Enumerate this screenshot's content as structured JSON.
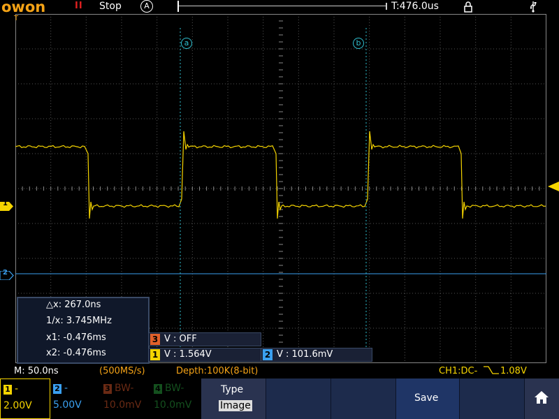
{
  "header": {
    "logo": "OWON",
    "run_icon": "II",
    "run_status": "Stop",
    "trigger_mode": "A",
    "trigger_time": "T:476.0us",
    "lock_icon": "lock-icon",
    "usb_icon": "usb-icon"
  },
  "markers": {
    "trigger_top": "T",
    "ch1": "1",
    "ch2": "2",
    "trigger_level": "trigger-level-arrow",
    "cursor_a": "a",
    "cursor_b": "b"
  },
  "measure": {
    "dx": "△x: 267.0ns",
    "inv_dx": "1/x: 3.745MHz",
    "x1": "x1: -0.476ms",
    "x2": "x2: -0.476ms"
  },
  "cursor_values": {
    "ch3": {
      "badge": "3",
      "text": "V : OFF"
    },
    "ch1": {
      "badge": "1",
      "text": "V : 1.564V"
    },
    "ch2": {
      "badge": "2",
      "text": "V : 101.6mV"
    }
  },
  "status": {
    "timebase": "M: 50.0ns",
    "sample_rate": "(500MS/s)",
    "depth": "Depth:100K(8-bit)",
    "trigger_info": "CH1:DC-",
    "trigger_level": "1.08V"
  },
  "menu": {
    "ch1": {
      "badge": "1",
      "top": "-",
      "value": "2.00V"
    },
    "ch2": {
      "badge": "2",
      "top": "-",
      "value": "5.00V"
    },
    "ch3": {
      "badge": "3",
      "top": "BW-",
      "value": "10.0mV"
    },
    "ch4": {
      "badge": "4",
      "top": "BW-",
      "value": "10.0mV"
    },
    "type_label": "Type",
    "type_value": "Image",
    "save_label": "Save",
    "home_icon": "home-icon"
  },
  "colors": {
    "ch1": "#f5d400",
    "ch2": "#3aa0f0",
    "ch3": "#e0602a",
    "ch4": "#2aa040",
    "cursor": "#2fc0d0",
    "logo": "#f5a316"
  }
}
